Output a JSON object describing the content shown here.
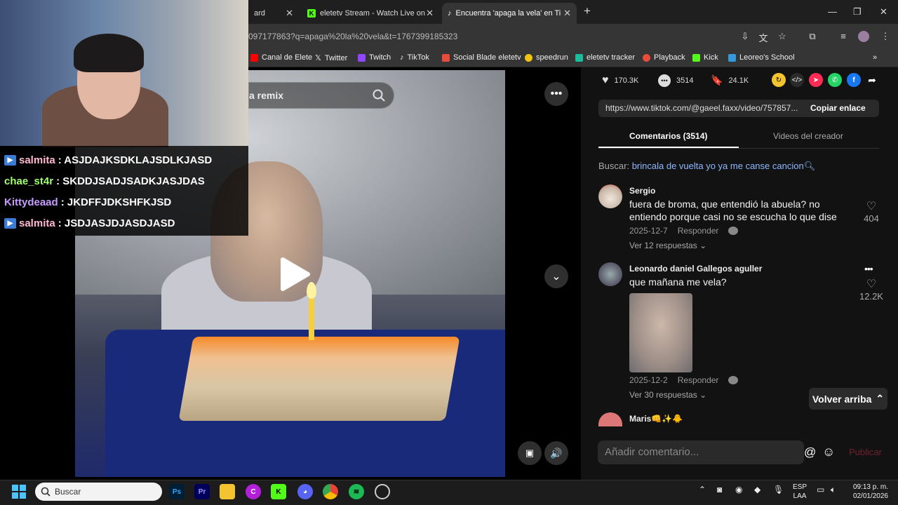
{
  "browser": {
    "tabs": [
      {
        "label": "ard"
      },
      {
        "label": "eletetv Stream - Watch Live on"
      },
      {
        "label": "Encuentra 'apaga la vela' en Tik"
      }
    ],
    "url": "097177863?q=apaga%20la%20vela&t=1767399185323",
    "bookmarks": [
      {
        "label": "Canal de Elete",
        "color": "#ff0000"
      },
      {
        "label": "Twitter",
        "color": "#ffffff"
      },
      {
        "label": "Twitch",
        "color": "#9146ff"
      },
      {
        "label": "TikTok",
        "color": "#ffffff"
      },
      {
        "label": "Social Blade eletetv",
        "color": "#e74c3c"
      },
      {
        "label": "speedrun",
        "color": "#f1c40f"
      },
      {
        "label": "eletetv tracker",
        "color": "#1abc9c"
      },
      {
        "label": "Playback",
        "color": "#e74c3c"
      },
      {
        "label": "Kick",
        "color": "#53fc18"
      },
      {
        "label": "Leoreo's School",
        "color": "#3498db"
      }
    ]
  },
  "video": {
    "search_text": "a remix"
  },
  "chat": [
    {
      "user": "salmita",
      "msg": ": ASJDAJKSDKLAJSDLKJASD",
      "color": "#ffb8d0",
      "badge": true
    },
    {
      "user": "chae_st4r",
      "msg": ": SKDDJSADJSADKJASJDAS",
      "color": "#9eff6b",
      "badge": false
    },
    {
      "user": "Kittydeaad",
      "msg": ": JKDFFJDKSHFKJSD",
      "color": "#c79cff",
      "badge": false
    },
    {
      "user": "salmita",
      "msg": ": JSDJASJDJASDJASD",
      "color": "#ffb8d0",
      "badge": true
    }
  ],
  "panel": {
    "stats": {
      "likes": "170.3K",
      "comments": "3514",
      "saves": "24.1K"
    },
    "link": "https://www.tiktok.com/@gaeel.faxx/video/757857...",
    "copy_label": "Copiar enlace",
    "tab_comments": "Comentarios (3514)",
    "tab_creator": "Videos del creador",
    "search_prefix": "Buscar:",
    "search_query": "brincala de vuelta yo ya me canse cancion",
    "comments": [
      {
        "name": "Sergio",
        "text": "fuera de broma, que entendió la abuela? no entiendo porque casi no se escucha lo que dise",
        "date": "2025-12-7",
        "reply": "Responder",
        "likes": "404",
        "more_replies": "Ver 12 respuestas"
      },
      {
        "name": "Leonardo daniel Gallegos aguller",
        "text": "que mañana me vela?",
        "date": "2025-12-2",
        "reply": "Responder",
        "likes": "12.2K",
        "more_replies": "Ver 30 respuestas"
      },
      {
        "name": "Maris👊✨🐥"
      }
    ],
    "back_to_top": "Volver arriba",
    "comment_placeholder": "Añadir comentario...",
    "publish": "Publicar"
  },
  "taskbar": {
    "search_placeholder": "Buscar",
    "lang_line1": "ESP",
    "lang_line2": "LAA",
    "time": "09:13 p. m.",
    "date": "02/01/2026"
  }
}
